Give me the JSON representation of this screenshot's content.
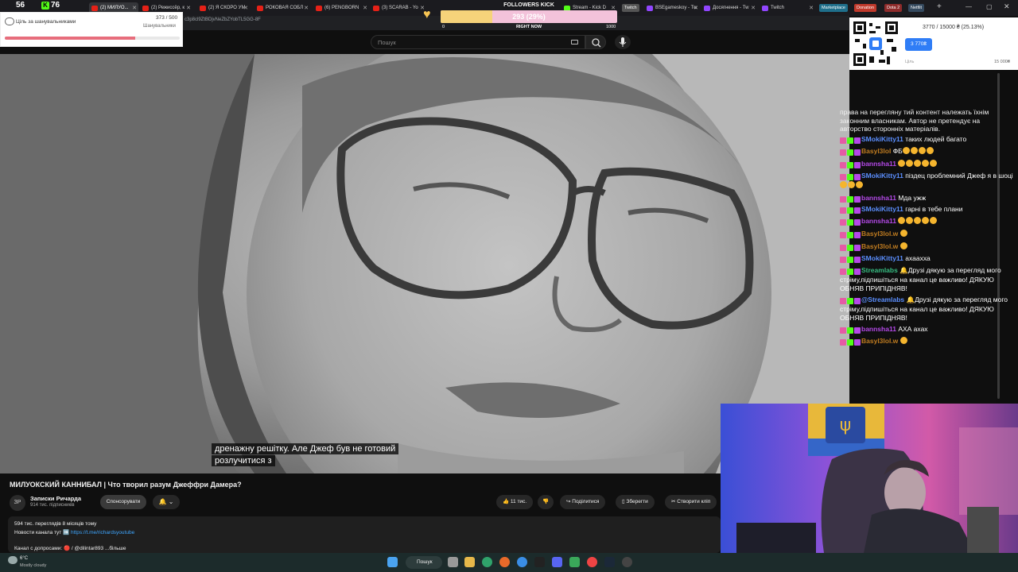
{
  "browser": {
    "tabs": [
      {
        "label": "(2) МИЛУО..."
      },
      {
        "label": "(2) Режиссёр, к"
      },
      {
        "label": "(2) Я СКОРО УМ"
      },
      {
        "label": "РОКОВАЯ СОБЛ"
      },
      {
        "label": "(6) PENGBORN"
      },
      {
        "label": "(3) SCARAB - Yo"
      },
      {
        "label": "Документ.. 6..."
      },
      {
        "label": "Stream - Kick D"
      },
      {
        "label": "BSEgameskoy - Tw"
      },
      {
        "label": "Досягнення - Tw"
      },
      {
        "label": "Twitch"
      }
    ],
    "pills": [
      {
        "label": "Twitch",
        "color": "#555555"
      },
      {
        "label": "Marketplace",
        "color": "#1f6f8b"
      },
      {
        "label": "Donation",
        "color": "#c0392b"
      },
      {
        "label": "Dota 2",
        "color": "#8e2b2b"
      },
      {
        "label": "Netfilt",
        "color": "#34495e"
      }
    ],
    "url": "c3p8cl9ZtBDjvNeZbZYobTL5GG-8F"
  },
  "youtube": {
    "search_placeholder": "Пошук",
    "captions": [
      "дренажну решітку. Але Джеф був не готовий",
      "розлучитися з"
    ],
    "video_title": "МИЛУОКСКИЙ КАННИБАЛ | Что творил разум Джеффри Дамера?",
    "avatar_text": "ЗР",
    "channel_name": "Записки Ричарда",
    "channel_subs": "914 тис. підписників",
    "sponsor_label": "Спонсорувати",
    "bell_label": "🔔 ⌄",
    "actions": {
      "likes": "11 тис.",
      "share": "Поділитися",
      "save": "Зберегти",
      "clip": "Створити кліп"
    },
    "description": {
      "stats": "594 тис. переглядів  8 місяців тому",
      "news_prefix": "Новости канала тут ➡️ ",
      "news_link": "https://t.me/richardsyoutube",
      "channel_line": "Канал с допросами: 🔴 / @dilintar893 ...більше"
    }
  },
  "overlay": {
    "count_left": "56",
    "kick_letter": "K",
    "count_right": "76",
    "goal_label": "Ціль за шанувальниками",
    "goal_count": "373 / 500",
    "goal_sub": "Шанувальники",
    "goal_fraction": 0.746,
    "followers_title": "FOLLOWERS KICK",
    "followers_value": "293 (29%)",
    "followers_fraction": 0.293,
    "followers_min": "0",
    "followers_mid": "RIGHT NOW",
    "followers_max": "1000",
    "donation_progress": "3770 / 15000 ₴ (25.13%)",
    "donation_chip": "3 770₴",
    "donation_goal_label": "Ціль",
    "donation_goal_amount": "15 000₴"
  },
  "chat": {
    "notice": "права на перегляну тий контент належать їхнім законним власникам. Автор не претендує на авторство сторонніх матеріалів.",
    "messages": [
      {
        "user": "SMokiKitty11",
        "user_color": "#5b8fff",
        "text": "таких людей багато",
        "emotes": 0
      },
      {
        "user": "Basyl3lol",
        "user_color": "#c07c20",
        "text": "ФБ",
        "emotes": 4
      },
      {
        "user": "bannsha11",
        "user_color": "#b449e8",
        "text": "",
        "emotes": 5
      },
      {
        "user": "SMokiKitty11",
        "user_color": "#5b8fff",
        "text": "піздец проблемний Джеф я в шоці",
        "emotes": 3
      },
      {
        "user": "bannsha11",
        "user_color": "#b449e8",
        "text": "Мда ужж",
        "emotes": 0
      },
      {
        "user": "SMokiKitty11",
        "user_color": "#5b8fff",
        "text": "гарні в тебе плани",
        "emotes": 0
      },
      {
        "user": "bannsha11",
        "user_color": "#b449e8",
        "text": "",
        "emotes": 5
      },
      {
        "user": "Basyl3lol.w",
        "user_color": "#c07c20",
        "text": "",
        "emotes": 1
      },
      {
        "user": "Basyl3lol.w",
        "user_color": "#c07c20",
        "text": "",
        "emotes": 1
      },
      {
        "user": "SMokiKitty11",
        "user_color": "#5b8fff",
        "text": "ахаахха",
        "emotes": 0
      },
      {
        "user": "Streamlabs",
        "user_color": "#37bd82",
        "text": "🔔Друзі дякую за перегляд мого стріму,підпишіться на канал це важливо! ДЯКУЮ ОБНЯВ ПРИПІДНЯВ!",
        "emotes": 0
      },
      {
        "user": "@Streamlabs",
        "user_color": "#5b8fff",
        "text": "🔔Друзі дякую за перегляд мого стріму,підпишіться на канал це важливо! ДЯКУЮ ОБНЯВ ПРИПІДНЯВ!",
        "emotes": 0
      },
      {
        "user": "bannsha11",
        "user_color": "#b449e8",
        "text": "АХА ахах",
        "emotes": 0
      },
      {
        "user": "Basyl3lol.w",
        "user_color": "#c07c20",
        "text": "",
        "emotes": 1
      }
    ]
  },
  "taskbar": {
    "temperature": "6°C",
    "weather": "Mostly cloudy",
    "search_label": "Пошук"
  },
  "colors": {
    "accent_pink": "#e76d7c",
    "kick_green": "#53fc18",
    "youtube_red": "#e62117",
    "link_blue": "#3ea6ff"
  }
}
